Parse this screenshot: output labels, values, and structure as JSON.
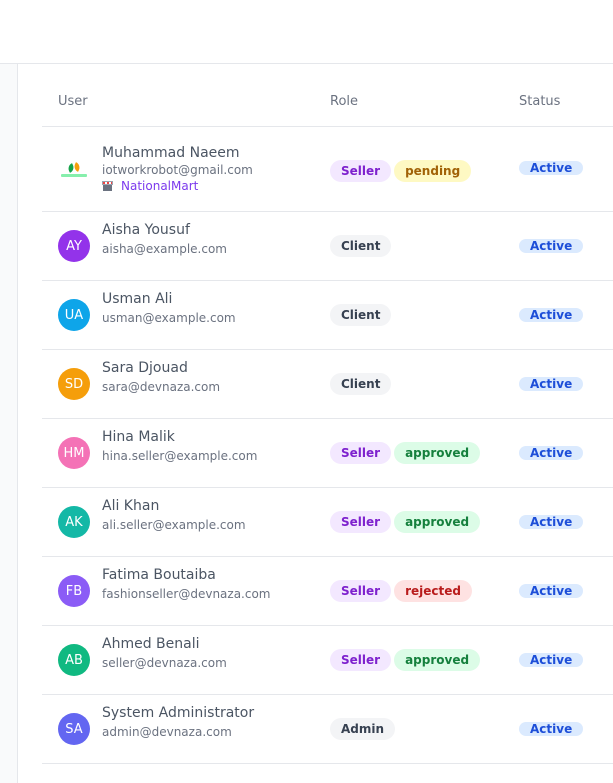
{
  "table": {
    "headers": {
      "user": "User",
      "role": "Role",
      "status": "Status"
    }
  },
  "colors": {
    "seller_badge": "#f3e8ff",
    "client_badge": "#f3f4f6",
    "pending_badge": "#fef9c3",
    "approved_badge": "#dcfce7",
    "rejected_badge": "#fee2e2",
    "active_badge": "#dbeafe"
  },
  "users": [
    {
      "name": "Muhammad Naeem",
      "email": "iotworkrobot@gmail.com",
      "store": "NationalMart",
      "avatar_icon": "company-logo-icon",
      "role": "Seller",
      "seller_status": "pending",
      "status": "Active"
    },
    {
      "name": "Aisha Yousuf",
      "email": "aisha@example.com",
      "initials": "AY",
      "avatar_color": "#9333ea",
      "role": "Client",
      "status": "Active"
    },
    {
      "name": "Usman Ali",
      "email": "usman@example.com",
      "initials": "UA",
      "avatar_color": "#0ea5e9",
      "role": "Client",
      "status": "Active"
    },
    {
      "name": "Sara Djouad",
      "email": "sara@devnaza.com",
      "initials": "SD",
      "avatar_color": "#f59e0b",
      "role": "Client",
      "status": "Active"
    },
    {
      "name": "Hina Malik",
      "email": "hina.seller@example.com",
      "initials": "HM",
      "avatar_color": "#f472b6",
      "role": "Seller",
      "seller_status": "approved",
      "status": "Active"
    },
    {
      "name": "Ali Khan",
      "email": "ali.seller@example.com",
      "initials": "AK",
      "avatar_color": "#14b8a6",
      "role": "Seller",
      "seller_status": "approved",
      "status": "Active"
    },
    {
      "name": "Fatima Boutaiba",
      "email": "fashionseller@devnaza.com",
      "initials": "FB",
      "avatar_color": "#8b5cf6",
      "role": "Seller",
      "seller_status": "rejected",
      "status": "Active"
    },
    {
      "name": "Ahmed Benali",
      "email": "seller@devnaza.com",
      "initials": "AB",
      "avatar_color": "#10b981",
      "role": "Seller",
      "seller_status": "approved",
      "status": "Active"
    },
    {
      "name": "System Administrator",
      "email": "admin@devnaza.com",
      "initials": "SA",
      "avatar_color": "#6366f1",
      "role": "Admin",
      "status": "Active"
    }
  ]
}
